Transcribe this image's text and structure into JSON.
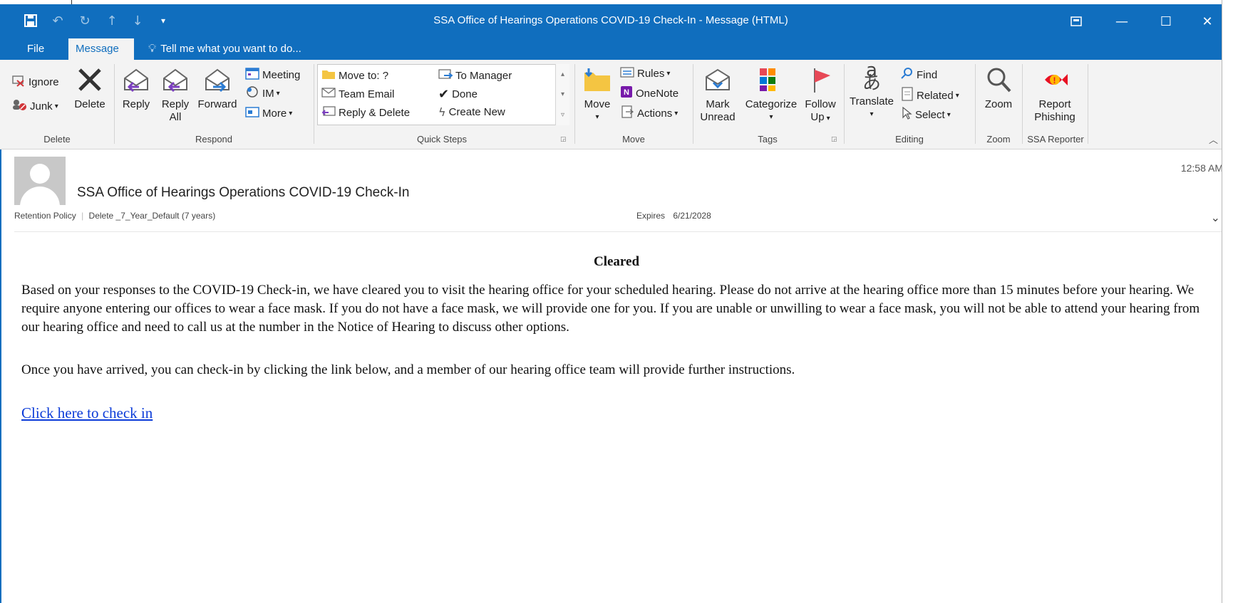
{
  "window": {
    "title": "SSA Office of Hearings Operations COVID-19 Check-In - Message (HTML)",
    "quick_access": {
      "save": "save-icon",
      "undo": "undo-icon",
      "redo": "redo-icon",
      "up": "up-arrow-icon",
      "down": "down-arrow-icon",
      "more": "customize-icon"
    },
    "controls": {
      "ribbon_display": "ribbon-display-icon",
      "minimize": "—",
      "maximize": "☐",
      "close": "✕"
    }
  },
  "tabs": {
    "file": "File",
    "message": "Message",
    "tell_me": "Tell me what you want to do..."
  },
  "ribbon": {
    "delete_group": {
      "ignore": "Ignore",
      "junk": "Junk",
      "delete": "Delete",
      "label": "Delete"
    },
    "respond_group": {
      "reply": "Reply",
      "reply_all_1": "Reply",
      "reply_all_2": "All",
      "forward": "Forward",
      "meeting": "Meeting",
      "im": "IM",
      "more": "More",
      "label": "Respond"
    },
    "quick_steps_group": {
      "move_to": "Move to: ?",
      "team_email": "Team Email",
      "reply_delete": "Reply & Delete",
      "to_manager": "To Manager",
      "done": "Done",
      "create_new": "Create New",
      "label": "Quick Steps"
    },
    "move_group": {
      "move": "Move",
      "rules": "Rules",
      "onenote": "OneNote",
      "actions": "Actions",
      "label": "Move"
    },
    "tags_group": {
      "mark_unread_1": "Mark",
      "mark_unread_2": "Unread",
      "categorize": "Categorize",
      "follow_up_1": "Follow",
      "follow_up_2": "Up",
      "label": "Tags"
    },
    "editing_group": {
      "translate": "Translate",
      "find": "Find",
      "related": "Related",
      "select": "Select",
      "label": "Editing"
    },
    "zoom_group": {
      "zoom": "Zoom",
      "label": "Zoom"
    },
    "ssa_group": {
      "report_1": "Report",
      "report_2": "Phishing",
      "label": "SSA Reporter"
    }
  },
  "message": {
    "subject": "SSA Office of Hearings Operations COVID-19 Check-In",
    "time": "12:58 AM",
    "retention_label": "Retention Policy",
    "retention_value": "Delete _7_Year_Default (7 years)",
    "expires_label": "Expires",
    "expires_value": "6/21/2028",
    "body": {
      "heading": "Cleared",
      "para1": "Based on your responses to the COVID-19 Check-in, we have cleared you to visit the hearing office for your scheduled hearing. Please do not arrive at the hearing office more than 15 minutes before your hearing. We require anyone entering our offices to wear a face mask. If you do not have a face mask, we will provide one for you.  If you are unable or unwilling to wear a face mask, you will not be able to attend your hearing from our hearing office and need to call us at the number in the Notice of Hearing to discuss other options.",
      "para2": "Once you have arrived, you can check-in by clicking the link below, and a member of our hearing office team will provide further instructions.",
      "link": "Click here to check in"
    }
  },
  "colors": {
    "accent": "#106ebe",
    "ribbon_bg": "#f3f3f3",
    "link": "#0b3bd8"
  }
}
